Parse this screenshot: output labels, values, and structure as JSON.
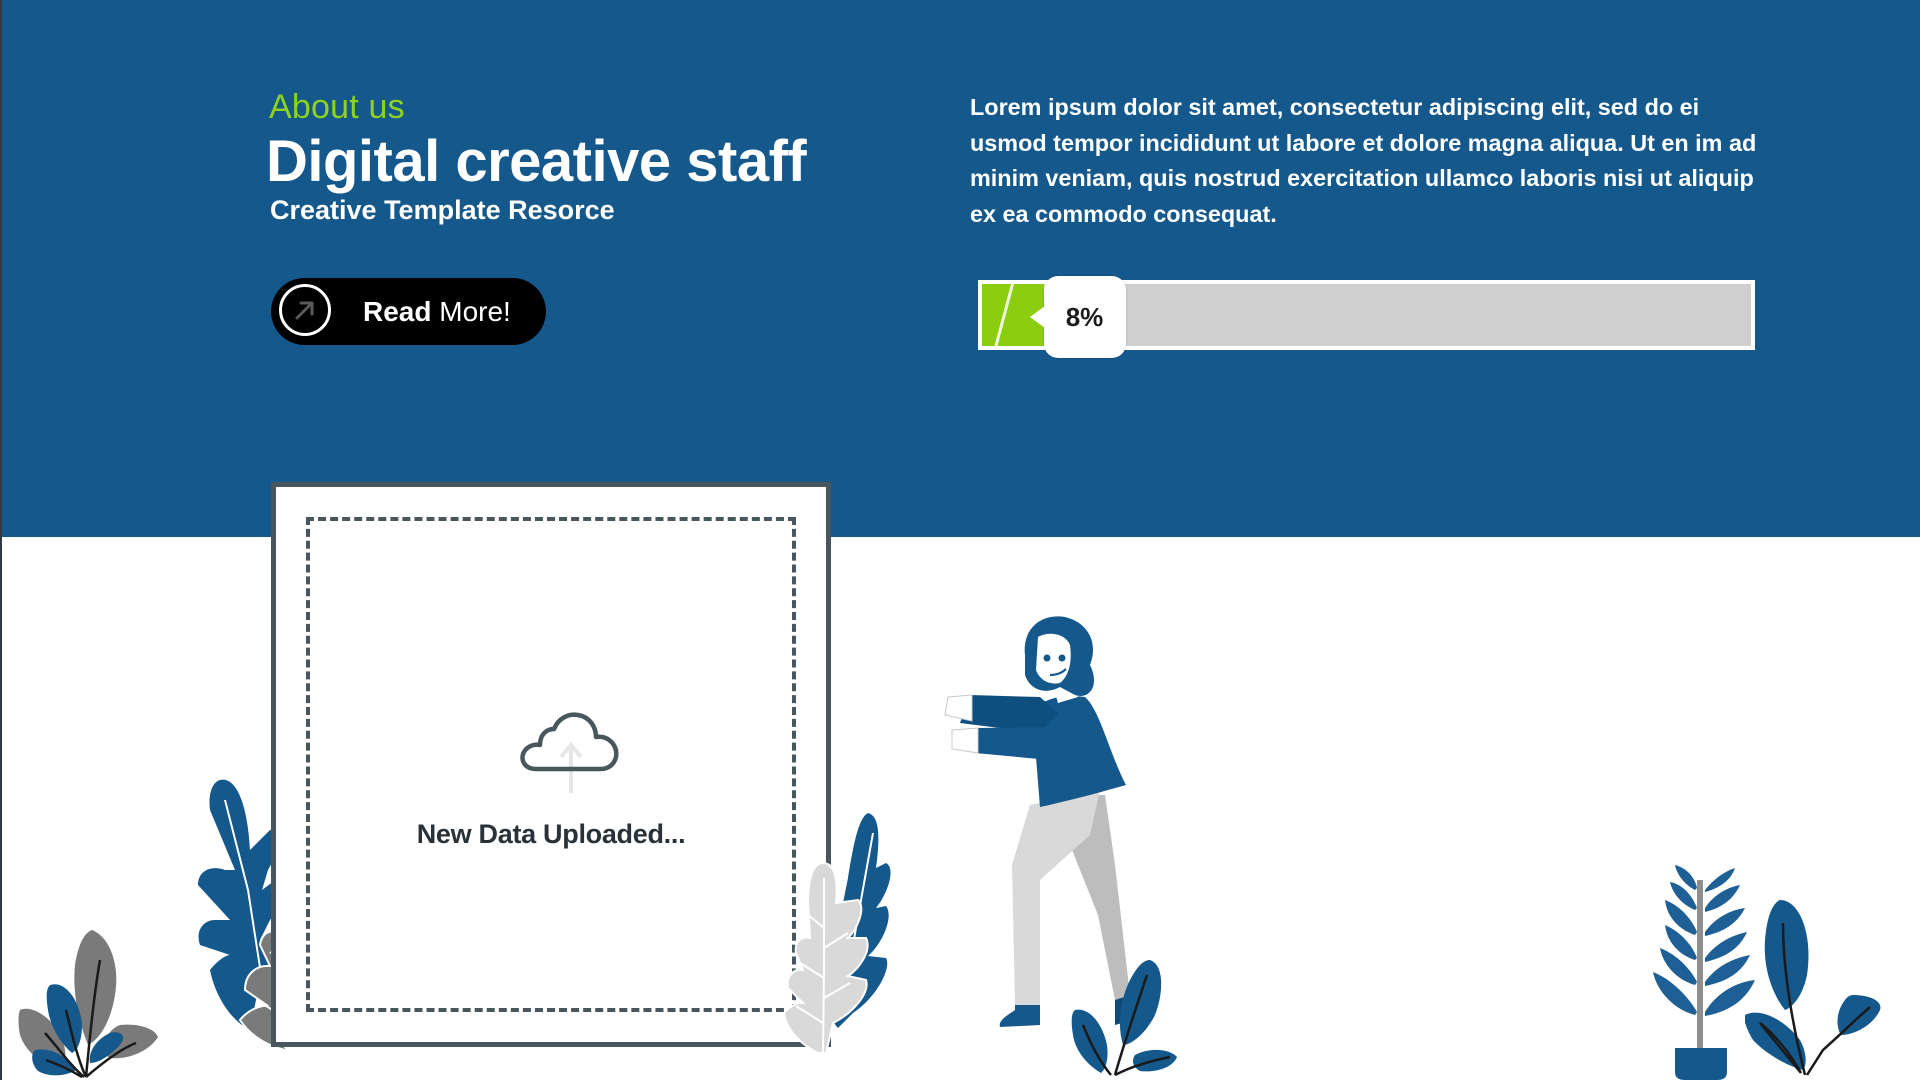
{
  "hero": {
    "eyebrow": "About us",
    "title": "Digital creative staff",
    "subtitle": "Creative Template Resorce",
    "read_more": {
      "label_bold": "Read",
      "label_regular": "More!",
      "icon": "arrow-up-right-icon"
    },
    "paragraph": "Lorem ipsum dolor sit amet, consectetur adipiscing elit, sed do ei usmod tempor incididunt ut labore et dolore magna aliqua.  Ut en im ad minim veniam, quis nostrud exercitation ullamco laboris nisi ut aliquip ex ea commodo consequat.",
    "progress": {
      "value_percent": 8,
      "label": "8%"
    }
  },
  "upload_card": {
    "icon": "cloud-upload-icon",
    "message": "New Data Uploaded..."
  },
  "illustrations": [
    "leaves-left-small",
    "leaves-behind-card-left",
    "leaves-behind-card-right",
    "person-pushing",
    "plant-small-center",
    "potted-plant-right",
    "leaves-right"
  ],
  "colors": {
    "primary_blue": "#14588c",
    "accent_green": "#8ed21c",
    "progress_fill": "#8ccd10",
    "progress_track": "#cfcfcf",
    "card_border": "#48565e",
    "button_bg": "#000000"
  }
}
